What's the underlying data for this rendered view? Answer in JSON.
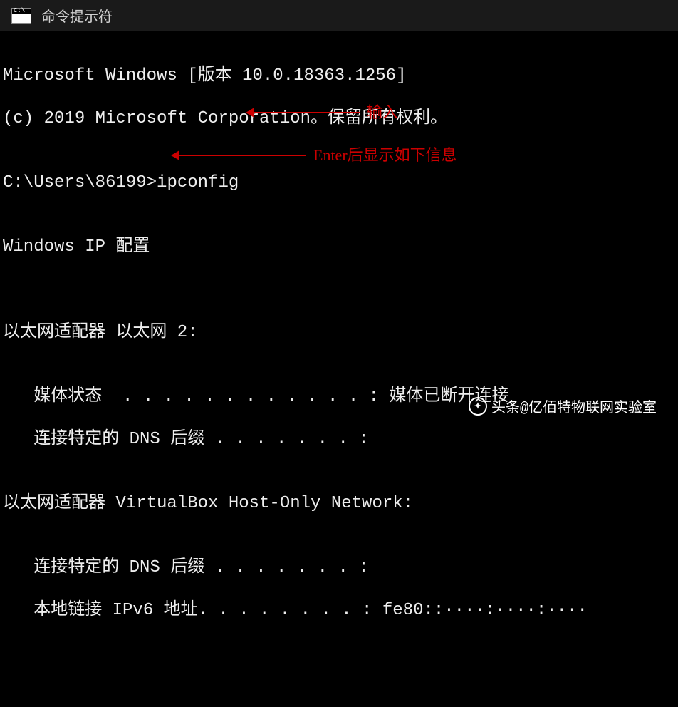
{
  "titlebar": {
    "icon_text": "C:\\",
    "title": "命令提示符"
  },
  "terminal": {
    "line1": "Microsoft Windows [版本 10.0.18363.1256]",
    "line2": "(c) 2019 Microsoft Corporation。保留所有权利。",
    "blank1": "",
    "prompt": "C:\\Users\\86199>ipconfig",
    "blank2": "",
    "header": "Windows IP 配置",
    "blank3": "",
    "blank4": "",
    "adapter1_title": "以太网适配器 以太网 2:",
    "blank5": "",
    "adapter1_media": "   媒体状态  . . . . . . . . . . . . : 媒体已断开连接",
    "adapter1_dns": "   连接特定的 DNS 后缀 . . . . . . . :",
    "blank6": "",
    "adapter2_title": "以太网适配器 VirtualBox Host-Only Network:",
    "blank7": "",
    "adapter2_dns": "   连接特定的 DNS 后缀 . . . . . . . :",
    "adapter2_ipv6": "   本地链接 IPv6 地址. . . . . . . . : fe80::····:····:····",
    "obscured_suffix": ""
  },
  "annotations": {
    "anno1": "输入",
    "anno2": "Enter后显示如下信息"
  },
  "watermark": {
    "prefix": "头条",
    "text": "@亿佰特物联网实验室"
  }
}
